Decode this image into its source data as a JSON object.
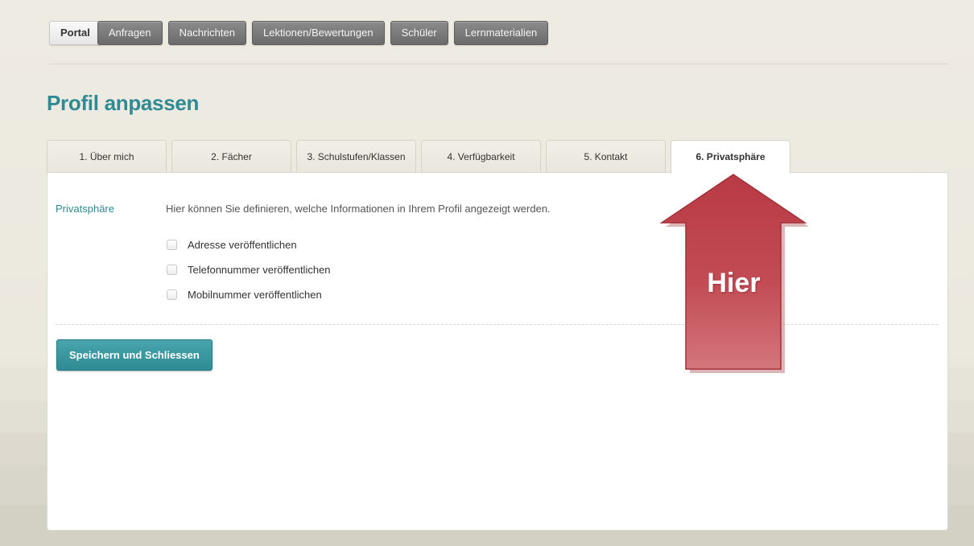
{
  "nav": {
    "items": [
      {
        "label": "Portal",
        "active": true
      },
      {
        "label": "Anfragen",
        "active": false
      },
      {
        "label": "Nachrichten",
        "active": false
      },
      {
        "label": "Lektionen/Bewertungen",
        "active": false
      },
      {
        "label": "Schüler",
        "active": false
      },
      {
        "label": "Lernmaterialien",
        "active": false
      }
    ]
  },
  "page": {
    "title": "Profil anpassen"
  },
  "tabs": [
    {
      "label": "1. Über mich",
      "active": false
    },
    {
      "label": "2. Fächer",
      "active": false
    },
    {
      "label": "3. Schulstufen/Klassen",
      "active": false
    },
    {
      "label": "4. Verfügbarkeit",
      "active": false
    },
    {
      "label": "5. Kontakt",
      "active": false
    },
    {
      "label": "6. Privatsphäre",
      "active": true
    }
  ],
  "privacy": {
    "section_label": "Privatsphäre",
    "description": "Hier können Sie definieren, welche Informationen in Ihrem Profil angezeigt werden.",
    "options": [
      {
        "label": "Adresse veröffentlichen",
        "checked": false
      },
      {
        "label": "Telefonnummer veröffentlichen",
        "checked": false
      },
      {
        "label": "Mobilnummer veröffentlichen",
        "checked": false
      }
    ]
  },
  "actions": {
    "save_label": "Speichern und Schliessen"
  },
  "annotation": {
    "label": "Hier",
    "color": "#c9535b"
  },
  "colors": {
    "accent": "#2f8a93",
    "arrow": "#c9535b"
  }
}
